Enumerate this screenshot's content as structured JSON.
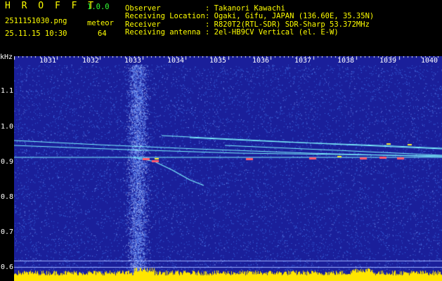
{
  "header": {
    "app_name": "H R O F F T",
    "version": "1.0.0",
    "filename": "2511151030.png",
    "datetime": "25.11.15 10:30",
    "count_label": "meteor",
    "count_value": "64",
    "info": [
      {
        "key": "Observer",
        "value": ": Takanori Kawachi"
      },
      {
        "key": "Receiving Location",
        "value": ": Ogaki, Gifu, JAPAN (136.60E, 35.35N)"
      },
      {
        "key": "Receiver",
        "value": ": R820T2(RTL-SDR) SDR-Sharp 53.372MHz"
      },
      {
        "key": "Receiving antenna",
        "value": ": 2el-HB9CV Vertical (el. E-W)"
      }
    ]
  },
  "spectrogram": {
    "y_unit": "kHz",
    "y_ticks": [
      "1.1",
      "1.0",
      "0.9",
      "0.8",
      "0.7",
      "0.6"
    ],
    "x_ticks": [
      "1031",
      "1032",
      "1033",
      "1034",
      "1035",
      "1036",
      "1037",
      "1038",
      "1039",
      "1040"
    ],
    "colors": {
      "background": "#1a1f9a",
      "noise": "#3c6ee6",
      "trace": "#7ff5ff",
      "meteor_hot": "#ff5a6e",
      "meteor_warm": "#ffee33",
      "baseline": "#ffe600",
      "baseline_cyan": "#20e0ff"
    }
  }
}
